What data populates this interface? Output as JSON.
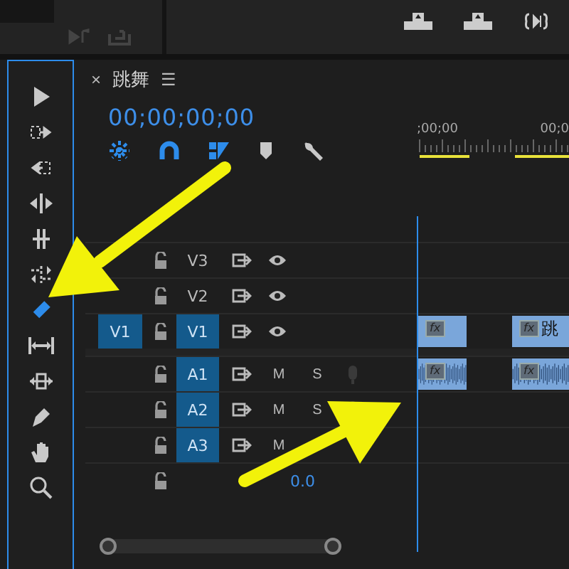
{
  "sequence_tab": {
    "close": "×",
    "title": "跳舞",
    "menu": "☰"
  },
  "timecode": "00;00;00;00",
  "ruler": {
    "labels": [
      ";00;00",
      "00;0"
    ]
  },
  "tools": [
    {
      "selected": false
    },
    {
      "selected": false
    },
    {
      "selected": false
    },
    {
      "selected": false
    },
    {
      "selected": false
    },
    {
      "selected": false
    },
    {
      "selected": true
    },
    {
      "selected": false
    },
    {
      "selected": false
    },
    {
      "selected": false
    },
    {
      "selected": false
    },
    {
      "selected": false
    }
  ],
  "tracks": [
    {
      "kind": "video",
      "name": "V3",
      "targeted": false
    },
    {
      "kind": "video",
      "name": "V2",
      "targeted": false
    },
    {
      "kind": "video",
      "name": "V1",
      "targeted": true,
      "source": "V1",
      "clips": [
        {
          "badge": "fx"
        },
        {
          "badge": "fx",
          "label": "跳"
        }
      ]
    },
    {
      "kind": "audio",
      "name": "A1",
      "targeted": true,
      "mute": "M",
      "solo": "S",
      "clips": [
        {
          "badge": "fx"
        },
        {
          "badge": "fx"
        }
      ]
    },
    {
      "kind": "audio",
      "name": "A2",
      "targeted": true,
      "mute": "M",
      "solo": "S"
    },
    {
      "kind": "audio",
      "name": "A3",
      "targeted": true,
      "mute": "M"
    },
    {
      "kind": "master",
      "volume": "0.0"
    }
  ]
}
